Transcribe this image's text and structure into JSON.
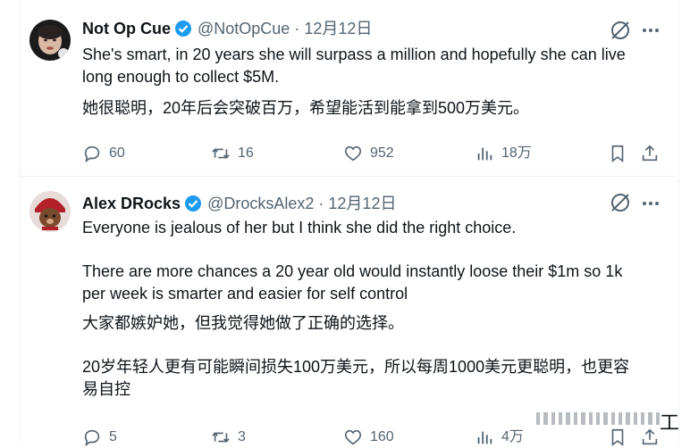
{
  "tweets": [
    {
      "name": "Not Op Cue",
      "handle": "@NotOpCue",
      "dot": "·",
      "date": "12月12日",
      "lines": [
        "She's smart, in 20 years she will surpass a million and hopefully she can live",
        "long enough to collect $5M.",
        "她很聪明，20年后会突破百万，希望能活到能拿到500万美元。"
      ],
      "stats": {
        "replies": "60",
        "reposts": "16",
        "likes": "952",
        "views": "18万"
      }
    },
    {
      "name": "Alex DRocks",
      "handle": "@DrocksAlex2",
      "dot": "·",
      "date": "12月12日",
      "lines": [
        "Everyone is jealous of her but I think she did the right choice.",
        "There are more chances a 20 year old would instantly loose their $1m so 1k",
        "per week is smarter and easier for self control",
        "大家都嫉妒她，但我觉得她做了正确的选择。",
        "20岁年轻人更有可能瞬间损失100万美元，所以每周1000美元更聪明，也更容",
        "易自控"
      ],
      "stats": {
        "replies": "5",
        "reposts": "3",
        "likes": "160",
        "views": "4万"
      }
    }
  ],
  "overlay": {
    "corner_glyph": "工"
  },
  "colors": {
    "verified_blue": "#1d9bf0",
    "muted_text": "#536471",
    "divider": "#eff3f4"
  }
}
